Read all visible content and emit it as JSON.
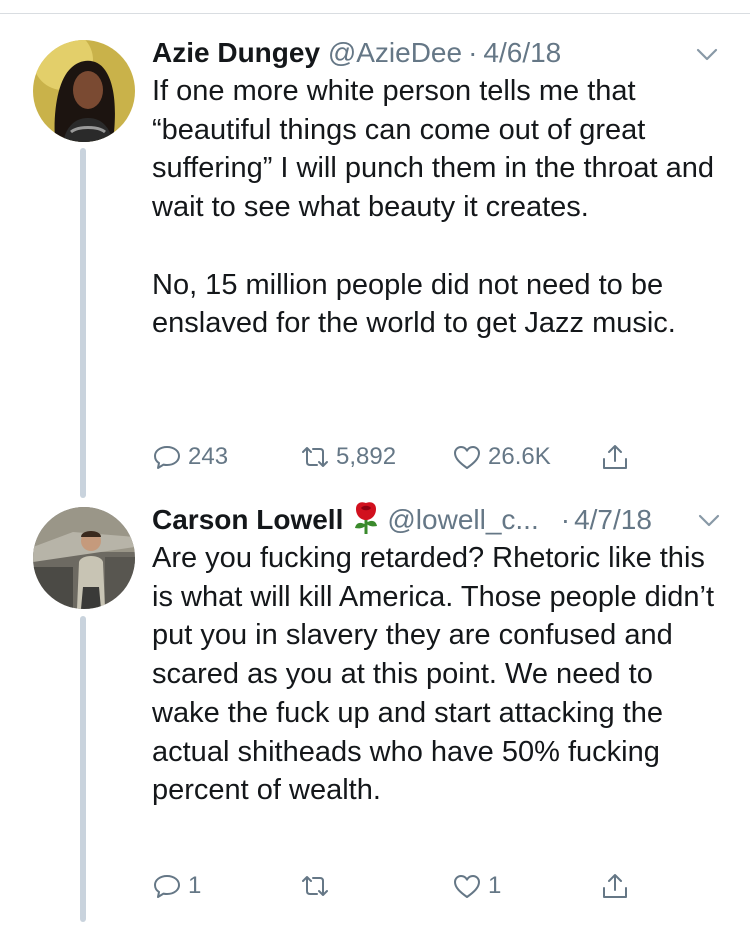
{
  "tweets": [
    {
      "name": "Azie Dungey",
      "handle": "@AzieDee",
      "date": "4/6/18",
      "body": "If one more white person tells me that “beautiful things can come out of great suffering” I will punch them in the throat and wait to see what beauty it creates.\n\nNo, 15 million people did not need to be enslaved for the world to get Jazz music.",
      "replies": "243",
      "retweets": "5,892",
      "likes": "26.6K"
    },
    {
      "name": "Carson Lowell",
      "name_emoji": "rose-icon",
      "handle": "@lowell_c...",
      "date": "4/7/18",
      "body": "Are you fucking retarded? Rhetoric like this is what will kill America. Those people didn’t put you in slavery they are confused and scared as you at this point. We need to wake the fuck up and start attacking the actual shitheads who have 50% fucking percent of wealth.",
      "replies": "1",
      "retweets": "",
      "likes": "1"
    }
  ],
  "separator": "·",
  "icons": [
    "reply-icon",
    "retweet-icon",
    "like-icon",
    "share-icon",
    "chevron-down-icon"
  ],
  "colors": {
    "text": "#14171a",
    "secondary": "#657786",
    "thread": "#c9d3dd"
  }
}
